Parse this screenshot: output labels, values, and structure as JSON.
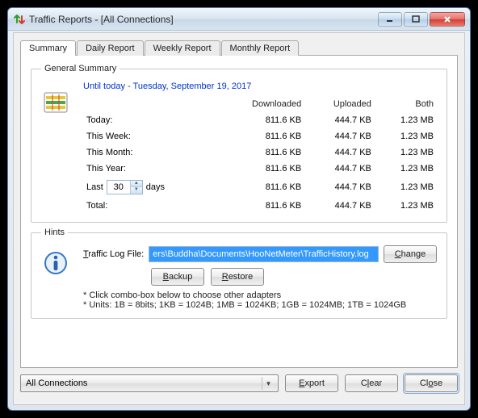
{
  "window": {
    "title": "Traffic Reports - [All Connections]"
  },
  "tabs": [
    "Summary",
    "Daily Report",
    "Weekly Report",
    "Monthly Report"
  ],
  "active_tab": 0,
  "summary": {
    "legend": "General Summary",
    "date_line": "Until today - Tuesday, September 19, 2017",
    "columns": [
      "",
      "Downloaded",
      "Uploaded",
      "Both"
    ],
    "rows": [
      {
        "label": "Today:",
        "down": "811.6 KB",
        "up": "444.7 KB",
        "both": "1.23 MB"
      },
      {
        "label": "This Week:",
        "down": "811.6 KB",
        "up": "444.7 KB",
        "both": "1.23 MB"
      },
      {
        "label": "This Month:",
        "down": "811.6 KB",
        "up": "444.7 KB",
        "both": "1.23 MB"
      },
      {
        "label": "This Year:",
        "down": "811.6 KB",
        "up": "444.7 KB",
        "both": "1.23 MB"
      }
    ],
    "last_row": {
      "prefix": "Last",
      "days_value": "30",
      "suffix": "days",
      "down": "811.6 KB",
      "up": "444.7 KB",
      "both": "1.23 MB"
    },
    "total_row": {
      "label": "Total:",
      "down": "811.6 KB",
      "up": "444.7 KB",
      "both": "1.23 MB"
    }
  },
  "hints": {
    "legend": "Hints",
    "log_label_prefix": "T",
    "log_label_rest": "raffic Log File:",
    "log_value": "ers\\Buddha\\Documents\\HooNetMeter\\TrafficHistory.log",
    "change_btn": "Change",
    "backup_btn": "Backup",
    "restore_btn": "Restore",
    "line1": "* Click combo-box below to choose other adapters",
    "line2": "* Units: 1B = 8bits; 1KB = 1024B; 1MB = 1024KB; 1GB = 1024MB; 1TB = 1024GB"
  },
  "bottom": {
    "adapter": "All Connections",
    "export": "Export",
    "clear": "Clear",
    "close": "Close"
  },
  "colors": {
    "link": "#0033cc",
    "selection": "#3399ff"
  }
}
